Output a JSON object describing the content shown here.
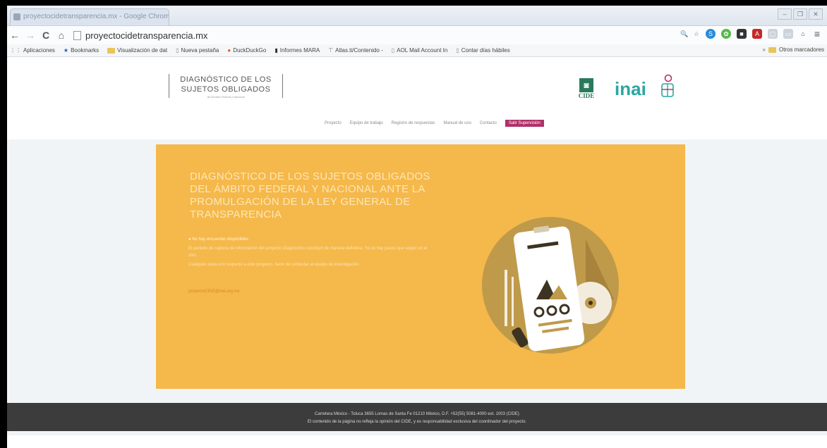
{
  "browser": {
    "tab_title": "proyectocidetransparencia.mx - Google Chrome",
    "url": "proyectocidetransparencia.mx",
    "window_controls": [
      "–",
      "❐",
      "✕"
    ],
    "nav": {
      "back": "←",
      "forward": "→",
      "reload": "C",
      "home": "⌂"
    },
    "bookmarks": [
      {
        "label": "Aplicaciones",
        "icon": "apps-icon"
      },
      {
        "label": "Bookmarks",
        "icon": "star-icon"
      },
      {
        "label": "Visualización de dat",
        "icon": "folder-icon"
      },
      {
        "label": "Nueva pestaña",
        "icon": "page-icon"
      },
      {
        "label": "DuckDuckGo",
        "icon": "duckduckgo-icon"
      },
      {
        "label": "Informes MARA",
        "icon": "chart-icon"
      },
      {
        "label": "Atlas.ti/Contenido - ",
        "icon": "atlas-icon"
      },
      {
        "label": "AOL Mail Account In",
        "icon": "page-icon"
      },
      {
        "label": "Contar días hábiles",
        "icon": "page-icon"
      }
    ],
    "other_bookmarks": "Otros marcadores"
  },
  "header": {
    "logo_line1": "DIAGNÓSTICO DE LOS",
    "logo_line2": "SUJETOS OBLIGADOS",
    "logo_sub": "del Ámbito Federal y Nacional",
    "cide_label": "CIDE",
    "inai_label": "inai",
    "nav": [
      "Proyecto",
      "Equipo de trabajo",
      "Registro de respuestas",
      "Manual de uso",
      "Contacto"
    ],
    "nav_highlight": "Salir Supervisión"
  },
  "hero": {
    "title": "DIAGNÓSTICO DE LOS SUJETOS OBLIGADOS DEL ÁMBITO FEDERAL Y NACIONAL ANTE LA PROMULGACIÓN DE LA LEY GENERAL DE TRANSPARENCIA",
    "bullet": "No hay encuestas disponibles",
    "para1": "El periodo de captura de información del proyecto Diagnóstico concluyó de manera definitiva. Ya no hay pasos que seguir en el sitio.",
    "para2": "Cualquier duda con respecto a este proyecto, favor de contactar al equipo de investigación.",
    "email": "proyectoCIDE@inai.org.mx",
    "colors": {
      "background": "#f5b84a",
      "illustration": "#bf9a4a"
    }
  },
  "footer": {
    "line1": "Carretera México - Toluca 3655 Lomas de Santa Fe 01210 México, D.F. +52(55) 5081-4000 ext. 1003 (CIDE)",
    "line2": "El contenido de la página no refleja la opinión del CIDE, y es responsabilidad exclusiva del coordinador del proyecto."
  }
}
